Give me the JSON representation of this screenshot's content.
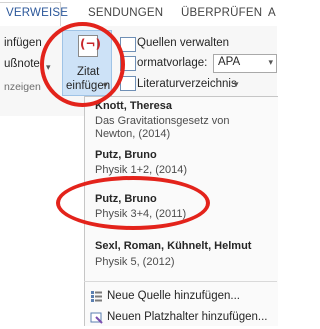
{
  "tabs": [
    {
      "label": "VERWEISE",
      "active": true
    },
    {
      "label": "SENDUNGEN",
      "active": false
    },
    {
      "label": "ÜBERPRÜFEN",
      "active": false
    },
    {
      "label": "A",
      "active": false
    }
  ],
  "ribbon": {
    "left_texts": [
      "infügen",
      "ußnote",
      "nzeigen"
    ],
    "insert_citation": {
      "line1": "Zitat",
      "line2": "einfügen"
    },
    "manage_sources": "Quellen verwalten",
    "format_label": "ormatvorlage:",
    "format_value": "APA",
    "bibliography": "Literaturverzeichnis"
  },
  "citations": [
    {
      "author": "Knott, Theresa",
      "detail": "Das Gravitationsgesetz von",
      "detail2": "Newton, (2014)"
    },
    {
      "author": "Putz, Bruno",
      "detail": "Physik 1+2, (2014)"
    },
    {
      "author": "Putz, Bruno",
      "detail": "Physik 3+4, (2011)"
    },
    {
      "author": "Sexl, Roman,  Kühnelt, Helmut",
      "detail": "Physik 5, (2012)"
    }
  ],
  "actions": {
    "new_source": "Neue Quelle hinzufügen...",
    "new_placeholder": "Neuen Platzhalter hinzufügen..."
  },
  "colors": {
    "accent": "#2b579a",
    "highlight_red": "#e3231b",
    "button_selected": "#cde2f7"
  }
}
